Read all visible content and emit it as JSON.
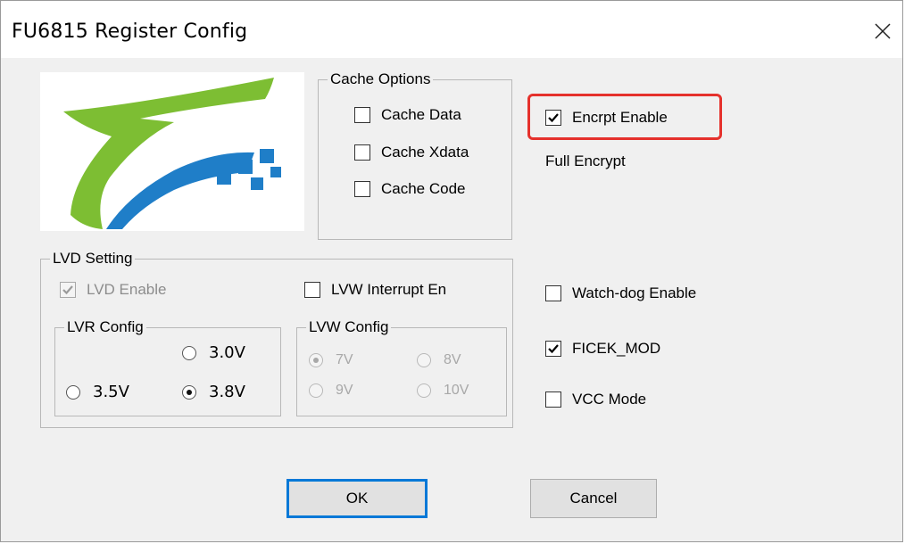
{
  "window": {
    "title": "FU6815 Register Config",
    "close_icon": "close-icon"
  },
  "logo": {
    "icon": "company-logo",
    "colors": {
      "green": "#7dbe33",
      "blue": "#1f7ec8"
    }
  },
  "cache_options": {
    "label": "Cache Options",
    "items": [
      {
        "label": "Cache Data",
        "checked": false
      },
      {
        "label": "Cache Xdata",
        "checked": false
      },
      {
        "label": "Cache Code",
        "checked": false
      }
    ]
  },
  "encrypt": {
    "enable_label": "Encrpt Enable",
    "enable_checked": true,
    "mode_text": "Full Encrypt",
    "highlight_color": "#e5312c"
  },
  "lvd": {
    "label": "LVD Setting",
    "enable_label": "LVD Enable",
    "enable_checked": true,
    "enable_disabled": true,
    "lvw_interrupt_label": "LVW Interrupt En",
    "lvw_interrupt_checked": false,
    "lvr": {
      "label": "LVR Config",
      "options": [
        {
          "label": "3.0V",
          "selected": false
        },
        {
          "label": "3.5V",
          "selected": false
        },
        {
          "label": "3.8V",
          "selected": true
        }
      ]
    },
    "lvw": {
      "label": "LVW Config",
      "disabled": true,
      "options": [
        {
          "label": "7V",
          "selected": true
        },
        {
          "label": "8V",
          "selected": false
        },
        {
          "label": "9V",
          "selected": false
        },
        {
          "label": "10V",
          "selected": false
        }
      ]
    }
  },
  "options": {
    "watchdog_label": "Watch-dog Enable",
    "watchdog_checked": false,
    "ficek_label": "FICEK_MOD",
    "ficek_checked": true,
    "vcc_label": "VCC Mode",
    "vcc_checked": false
  },
  "buttons": {
    "ok": "OK",
    "cancel": "Cancel"
  }
}
